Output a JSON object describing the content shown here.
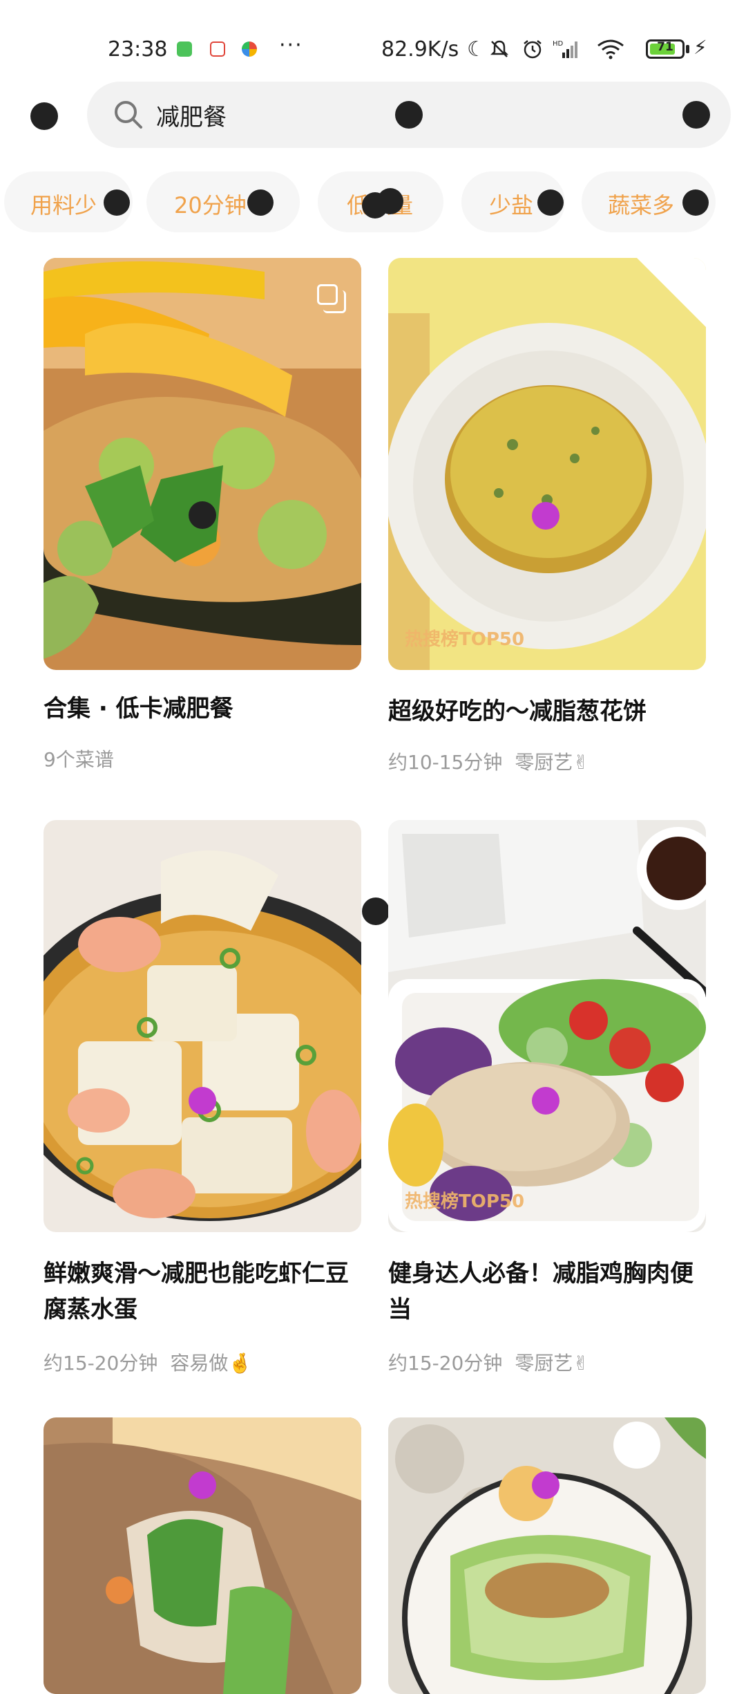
{
  "status_bar": {
    "time": "23:38",
    "dots": "···",
    "net_speed": "82.9K/s",
    "battery": "71",
    "icons": [
      "moon-icon",
      "mute-icon",
      "alarm-icon",
      "hd-signal-icon",
      "wifi-icon",
      "battery-icon",
      "charging-icon"
    ]
  },
  "search": {
    "query": "减肥餐",
    "icon": "search-icon"
  },
  "chips": [
    "用料少",
    "20分钟",
    "低",
    "少盐",
    "蔬菜多"
  ],
  "chip_suffix_hidden": "热量",
  "cards": [
    {
      "title": "合集 · 低卡减肥餐",
      "meta": [
        "9个菜谱"
      ],
      "badge": "",
      "icon": "collection-icon",
      "image": "quinoa-avocado-bowl"
    },
    {
      "title": "超级好吃的～减脂葱花饼",
      "meta": [
        "约10-15分钟",
        "零厨艺✌"
      ],
      "badge": "热搜榜TOP50",
      "image": "scallion-egg-pancake"
    },
    {
      "title": "鲜嫩爽滑～减肥也能吃虾仁豆腐蒸水蛋",
      "meta": [
        "约15-20分钟",
        "容易做🤞"
      ],
      "badge": "",
      "image": "shrimp-tofu-steamed-egg"
    },
    {
      "title": "健身达人必备！减脂鸡胸肉便当",
      "meta": [
        "约15-20分钟",
        "零厨艺✌"
      ],
      "badge": "热搜榜TOP50",
      "image": "chicken-breast-bento"
    },
    {
      "title": "",
      "meta": [],
      "badge": "",
      "image": "whole-wheat-wrap"
    },
    {
      "title": "",
      "meta": [],
      "badge": "",
      "image": "lettuce-plate"
    }
  ],
  "colors": {
    "chip_text": "#f0a24b",
    "chip_bg": "#f6f6f6",
    "search_bg": "#f2f2f2",
    "meta_text": "#9a9a9a",
    "marker_purple": "#c23bcf"
  }
}
